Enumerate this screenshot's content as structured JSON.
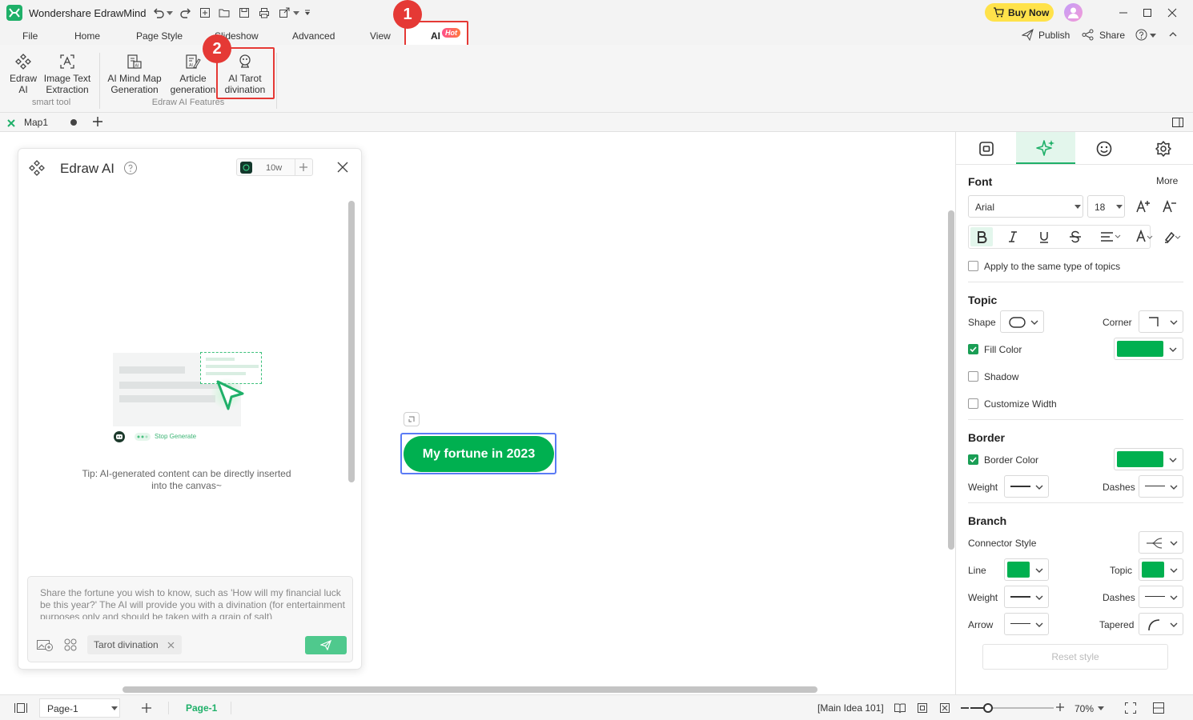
{
  "app": {
    "title": "Wondershare EdrawMind",
    "buy_now": "Buy Now"
  },
  "menu": {
    "items": [
      "File",
      "Home",
      "Page Style",
      "Slideshow",
      "Advanced",
      "View",
      "AI"
    ],
    "hot_badge": "Hot",
    "publish": "Publish",
    "share": "Share"
  },
  "ribbon": {
    "edraw_ai": "Edraw AI",
    "image_text": "Image Text Extraction",
    "smart_tool": "smart tool",
    "mind_map_gen": "AI Mind Map Generation",
    "article_gen": "Article generation",
    "tarot": "AI Tarot divination",
    "edraw_ai_features": "Edraw AI Features"
  },
  "annotations": {
    "step1": "1",
    "step2": "2"
  },
  "doc_tab": {
    "name": "Map1"
  },
  "ai_panel": {
    "title": "Edraw AI",
    "credits": "10w",
    "illustration_label": "Stop Generate",
    "tip": "Tip: AI-generated content can be directly inserted into the canvas~",
    "input_placeholder": "Share the fortune you wish to know, such as 'How will my financial luck be this year?' The AI will provide you with a divination (for entertainment purposes only and should be taken with a grain of salt)",
    "tag": "Tarot divination"
  },
  "canvas": {
    "topic": "My fortune in 2023"
  },
  "right_panel": {
    "font": {
      "title": "Font",
      "more": "More",
      "family": "Arial",
      "size": "18",
      "apply_same": "Apply to the same type of topics"
    },
    "topic": {
      "title": "Topic",
      "shape": "Shape",
      "corner": "Corner",
      "fill_color": "Fill Color",
      "shadow": "Shadow",
      "customize_width": "Customize Width"
    },
    "border": {
      "title": "Border",
      "border_color": "Border Color",
      "weight": "Weight",
      "dashes": "Dashes"
    },
    "branch": {
      "title": "Branch",
      "connector_style": "Connector Style",
      "line": "Line",
      "topic": "Topic",
      "weight": "Weight",
      "dashes": "Dashes",
      "arrow": "Arrow",
      "tapered": "Tapered"
    },
    "reset": "Reset style"
  },
  "status": {
    "page_select": "Page-1",
    "page_tab": "Page-1",
    "selection": "[Main Idea 101]",
    "zoom": "70%"
  },
  "colors": {
    "accent_green": "#00b050",
    "highlight_red": "#e53935",
    "selection_blue": "#5b7bf5"
  }
}
